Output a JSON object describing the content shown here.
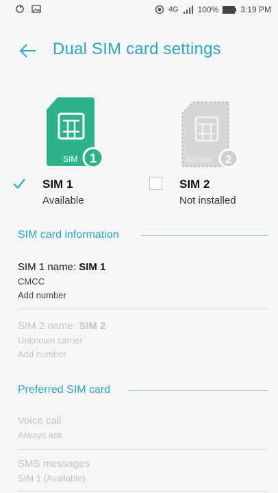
{
  "status_bar": {
    "left_icons": [
      "sync-icon",
      "image-icon"
    ],
    "network": "4G",
    "battery": "100%",
    "time": "3:19 PM"
  },
  "header": {
    "title": "Dual SIM card settings"
  },
  "sim_cards": [
    {
      "badge_label": "SIM",
      "badge_number": "1",
      "name": "SIM 1",
      "status": "Available",
      "checked": true,
      "color": "#2db38a"
    },
    {
      "badge_label": "NO SIM",
      "badge_number": "2",
      "name": "SIM 2",
      "status": "Not installed",
      "checked": false,
      "color": "#cfcfcf"
    }
  ],
  "sim_info": {
    "heading": "SIM card information",
    "sim1": {
      "name_label": "SIM 1 name: ",
      "name_value": "SIM 1",
      "carrier": "CMCC",
      "number": "Add number"
    },
    "sim2": {
      "name_label": "SIM 2 name: ",
      "name_value": "SIM 2",
      "carrier": "Unknown carrier",
      "number": "Add number"
    }
  },
  "preferred": {
    "heading": "Preferred SIM card",
    "voice": {
      "title": "Voice call",
      "value": "Always ask"
    },
    "sms": {
      "title": "SMS messages",
      "value": "SIM 1 (Available)"
    }
  },
  "colors": {
    "accent": "#29a6c3",
    "sim_active": "#2db38a",
    "sim_inactive": "#cfcfcf"
  }
}
